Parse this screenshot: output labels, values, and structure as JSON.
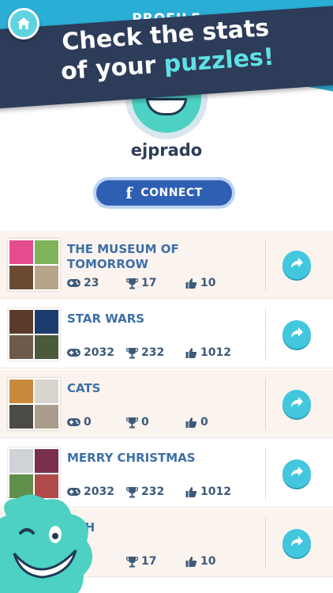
{
  "header": {
    "title": "PROFILE",
    "banner_line1": "Check the stats",
    "banner_line2_prefix": "of your ",
    "banner_line2_accent": "puzzles!",
    "home_icon": "home-icon"
  },
  "profile": {
    "username": "ejprado",
    "connect_label": "CONNECT",
    "facebook_glyph": "f"
  },
  "puzzles": [
    {
      "title": "THE MUSEUM OF TOMORROW",
      "plays": "23",
      "trophies": "17",
      "likes": "10",
      "thumb_colors": [
        "#e54d8c",
        "#7fb35a",
        "#6b4a33",
        "#b6a58a"
      ]
    },
    {
      "title": "STAR WARS",
      "plays": "2032",
      "trophies": "232",
      "likes": "1012",
      "thumb_colors": [
        "#5b3a2c",
        "#1e3b6d",
        "#6e5a4a",
        "#4a5a3a"
      ]
    },
    {
      "title": "CATS",
      "plays": "0",
      "trophies": "0",
      "likes": "0",
      "thumb_colors": [
        "#c98a3c",
        "#d8d5cf",
        "#4c4a45",
        "#a89c8c"
      ]
    },
    {
      "title": "MERRY CHRISTMAS",
      "plays": "2032",
      "trophies": "232",
      "likes": "1012",
      "thumb_colors": [
        "#cfd2d6",
        "#7a2f4e",
        "#5f8f4a",
        "#b04a4a"
      ]
    },
    {
      "title": "ACH",
      "plays": "",
      "trophies": "17",
      "likes": "10",
      "thumb_colors": [
        "#d8c9b4",
        "#8fa8c0",
        "#c9b087",
        "#7aa0b6"
      ]
    }
  ],
  "colors": {
    "sky": "#2aaed6",
    "banner": "#2d3c59",
    "accent": "#5fe1e6",
    "title": "#3d6fa8",
    "action": "#43c7df",
    "mascot": "#4cd1c3"
  }
}
